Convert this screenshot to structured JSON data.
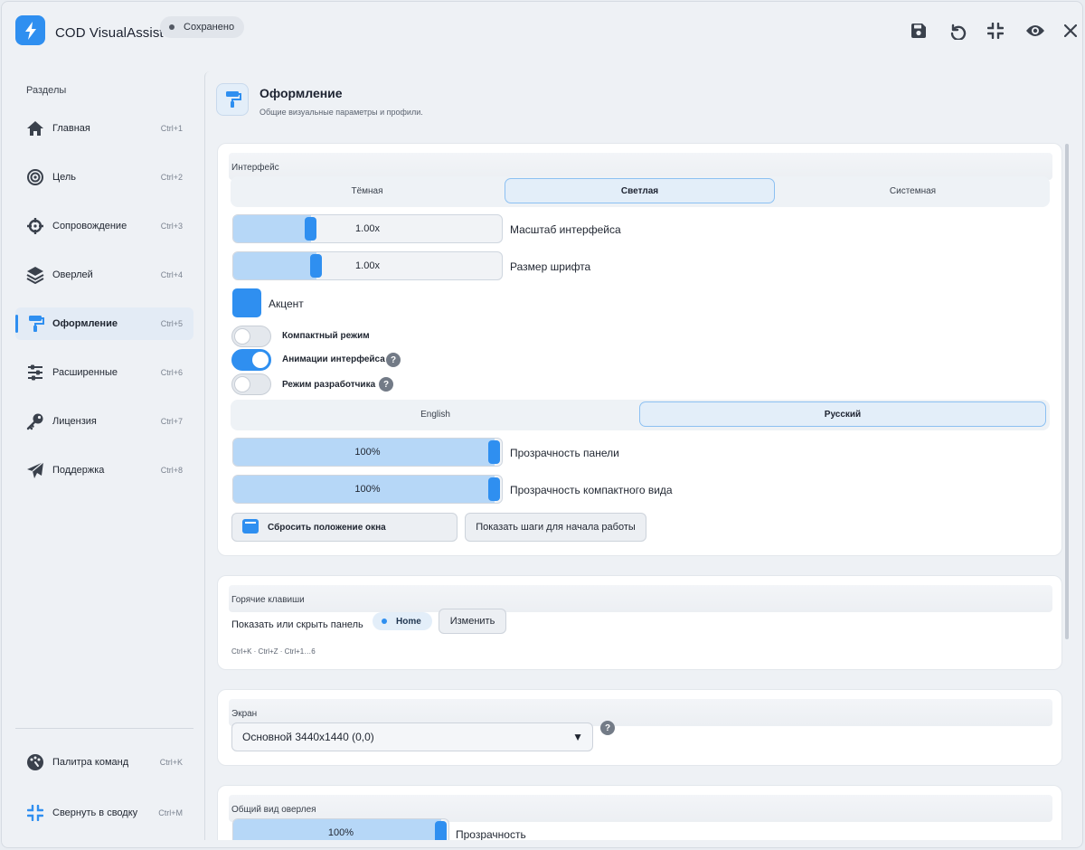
{
  "app": {
    "title": "COD VisualAssist",
    "status": "Сохранено",
    "accent": "#2f8ff0"
  },
  "toolbar": {
    "icons": [
      "save-icon",
      "undo-icon",
      "collapse-icon",
      "eye-icon",
      "close-icon"
    ]
  },
  "sidebar": {
    "heading": "Разделы",
    "items": [
      {
        "label": "Главная",
        "shortcut": "Ctrl+1",
        "icon": "home-icon"
      },
      {
        "label": "Цель",
        "shortcut": "Ctrl+2",
        "icon": "target-icon"
      },
      {
        "label": "Сопровождение",
        "shortcut": "Ctrl+3",
        "icon": "crosshair-icon"
      },
      {
        "label": "Оверлей",
        "shortcut": "Ctrl+4",
        "icon": "layers-icon"
      },
      {
        "label": "Оформление",
        "shortcut": "Ctrl+5",
        "icon": "paint-roller-icon",
        "active": true
      },
      {
        "label": "Расширенные",
        "shortcut": "Ctrl+6",
        "icon": "sliders-icon"
      },
      {
        "label": "Лицензия",
        "shortcut": "Ctrl+7",
        "icon": "key-icon"
      },
      {
        "label": "Поддержка",
        "shortcut": "Ctrl+8",
        "icon": "paper-plane-icon"
      }
    ],
    "footer": [
      {
        "label": "Палитра команд",
        "shortcut": "Ctrl+K",
        "icon": "palette-icon"
      },
      {
        "label": "Свернуть в сводку",
        "shortcut": "Ctrl+M",
        "icon": "compress-icon"
      }
    ]
  },
  "page": {
    "title": "Оформление",
    "subtitle": "Общие визуальные параметры и профили."
  },
  "interface": {
    "heading": "Интерфейс",
    "theme_options": [
      "Тёмная",
      "Светлая",
      "Системная"
    ],
    "theme_selected": "Светлая",
    "ui_scale": {
      "value": "1.00x",
      "label": "Масштаб интерфейса",
      "level": 0.29
    },
    "font_size": {
      "value": "1.00x",
      "label": "Размер шрифта",
      "level": 0.31
    },
    "accent_label": "Акцент",
    "toggles": [
      {
        "label": "Компактный режим",
        "on": false,
        "help": false
      },
      {
        "label": "Анимации интерфейса",
        "on": true,
        "help": true
      },
      {
        "label": "Режим разработчика",
        "on": false,
        "help": true
      }
    ],
    "help_glyph": "?",
    "language_options": [
      "English",
      "Русский"
    ],
    "language_selected": "Русский",
    "panel_opacity": {
      "value": "100%",
      "label": "Прозрачность панели",
      "level": 1.0
    },
    "compact_opacity": {
      "value": "100%",
      "label": "Прозрачность компактного вида",
      "level": 1.0
    },
    "reset_button": "Сбросить положение окна",
    "onboarding_button": "Показать шаги для начала работы"
  },
  "hotkeys": {
    "heading": "Горячие клавиши",
    "toggle_label": "Показать или скрыть панель",
    "key": "Home",
    "change_button": "Изменить",
    "hint": "Ctrl+K · Ctrl+Z · Ctrl+1…6"
  },
  "screen": {
    "heading": "Экран",
    "selected": "Основной  3440x1440  (0,0)",
    "arrow": "▼"
  },
  "overlay": {
    "heading": "Общий вид оверлея",
    "opacity": {
      "value": "100%",
      "label": "Прозрачность",
      "level": 1.0
    }
  }
}
